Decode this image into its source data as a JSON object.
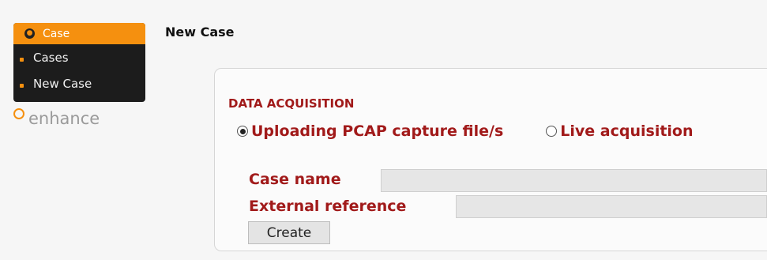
{
  "sidebar": {
    "header_label": "Case",
    "header_icon_glyph": "●",
    "items": [
      {
        "label": "Cases"
      },
      {
        "label": "New Case"
      }
    ],
    "accent_color": "#f5900f",
    "background_color": "#1c1c1c"
  },
  "logo": {
    "text": "enhance"
  },
  "page": {
    "title": "New Case"
  },
  "form": {
    "section_title": "DATA ACQUISITION",
    "acquisition_options": [
      {
        "label": "Uploading PCAP capture file/s",
        "selected": true
      },
      {
        "label": "Live acquisition",
        "selected": false
      }
    ],
    "fields": {
      "case_name": {
        "label": "Case name",
        "value": ""
      },
      "external_reference": {
        "label": "External reference",
        "value": ""
      }
    },
    "submit_label": "Create",
    "label_color": "#a11a1a"
  }
}
